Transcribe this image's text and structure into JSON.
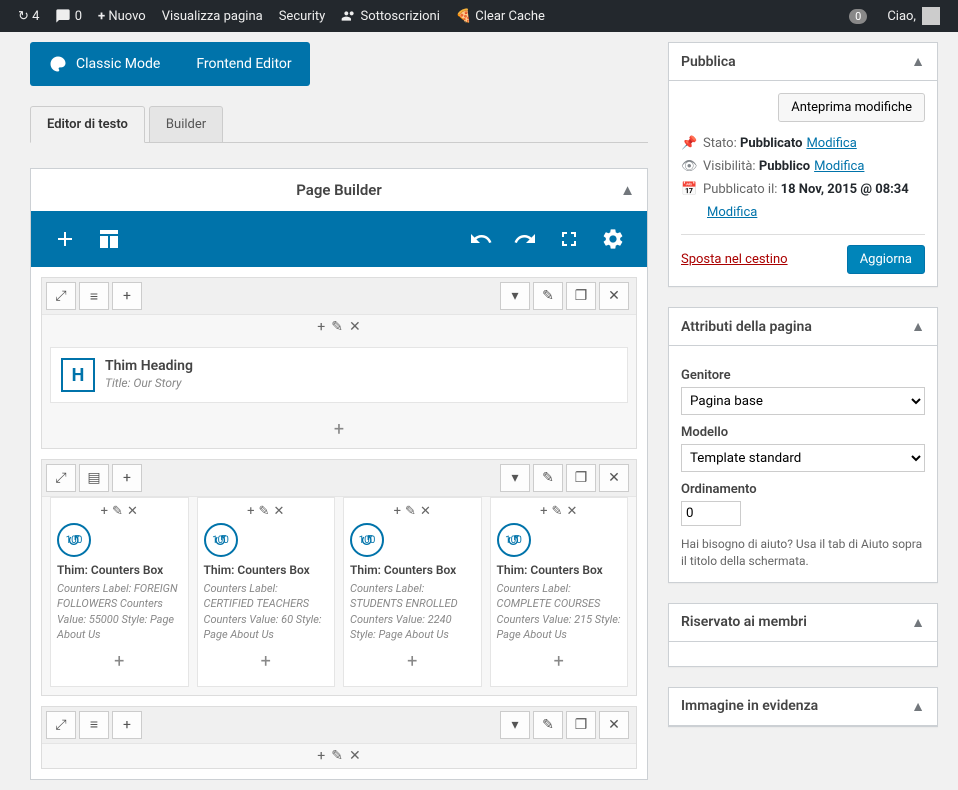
{
  "adminbar": {
    "updates": "4",
    "comments": "0",
    "new": "Nuovo",
    "view_page": "Visualizza pagina",
    "security": "Security",
    "subscriptions": "Sottoscrizioni",
    "clear_cache": "Clear Cache",
    "notif": "0",
    "greeting": "Ciao,"
  },
  "modes": {
    "classic": "Classic Mode",
    "frontend": "Frontend Editor"
  },
  "tabs": {
    "editor": "Editor di testo",
    "builder": "Builder"
  },
  "page_builder": {
    "title": "Page Builder",
    "rows": [
      {
        "elements": [
          {
            "type": "heading",
            "title": "Thim Heading",
            "subtitle": "Title: Our Story"
          }
        ]
      },
      {
        "columns": [
          {
            "title": "Thim: Counters Box",
            "desc": "Counters Label: FOREIGN FOLLOWERS  Counters Value: 55000  Style: Page About Us",
            "counter": "100"
          },
          {
            "title": "Thim: Counters Box",
            "desc": "Counters Label: CERTIFIED TEACHERS  Counters Value: 60  Style: Page About Us",
            "counter": "100"
          },
          {
            "title": "Thim: Counters Box",
            "desc": "Counters Label: STUDENTS ENROLLED  Counters Value: 2240  Style: Page About Us",
            "counter": "100"
          },
          {
            "title": "Thim: Counters Box",
            "desc": "Counters Label: COMPLETE COURSES  Counters Value: 215  Style: Page About Us",
            "counter": "100"
          }
        ]
      }
    ]
  },
  "publish": {
    "title": "Pubblica",
    "preview": "Anteprima modifiche",
    "status_label": "Stato:",
    "status": "Pubblicato",
    "edit": "Modifica",
    "vis_label": "Visibilità:",
    "vis": "Pubblico",
    "pub_label": "Pubblicato il:",
    "pub_date": "18 Nov, 2015 @ 08:34",
    "trash": "Sposta nel cestino",
    "update": "Aggiorna"
  },
  "attributes": {
    "title": "Attributi della pagina",
    "parent_label": "Genitore",
    "parent_value": "Pagina base",
    "template_label": "Modello",
    "template_value": "Template standard",
    "order_label": "Ordinamento",
    "order_value": "0",
    "help": "Hai bisogno di aiuto? Usa il tab di Aiuto sopra il titolo della schermata."
  },
  "members": {
    "title": "Riservato ai membri"
  },
  "featured": {
    "title": "Immagine in evidenza"
  }
}
